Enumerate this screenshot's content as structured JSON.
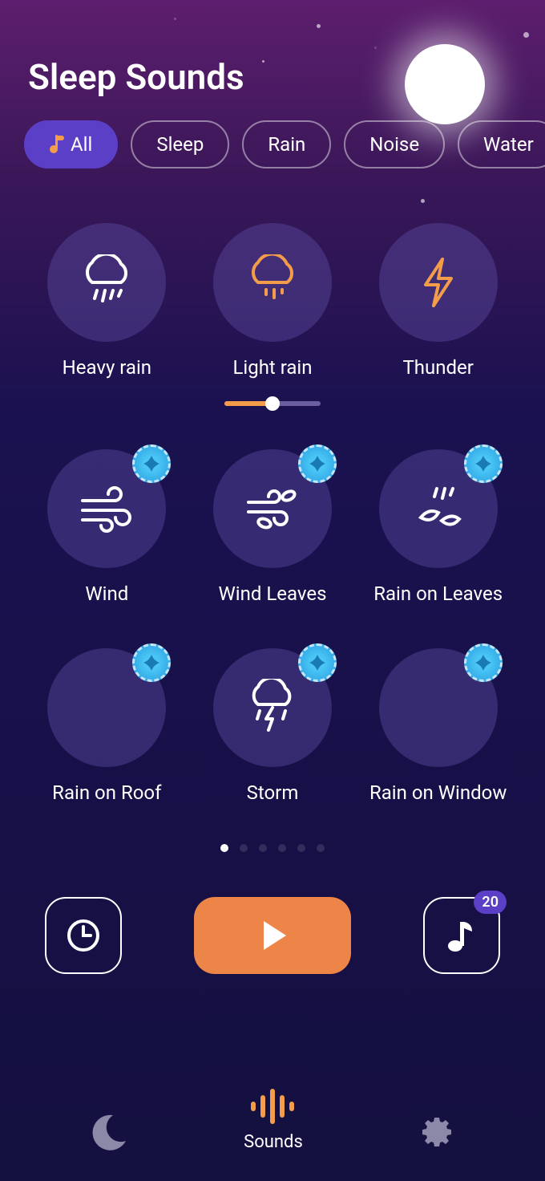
{
  "title": "Sleep Sounds",
  "colors": {
    "accent": "#f39c4a",
    "primary": "#5b3fc7",
    "play": "#ed8548"
  },
  "tabs": [
    {
      "label": "All",
      "active": true,
      "icon": "music-note-icon"
    },
    {
      "label": "Sleep",
      "active": false
    },
    {
      "label": "Rain",
      "active": false
    },
    {
      "label": "Noise",
      "active": false
    },
    {
      "label": "Water",
      "active": false
    }
  ],
  "sounds": [
    {
      "label": "Heavy rain",
      "icon": "heavy-rain-icon",
      "locked": false,
      "playing": false
    },
    {
      "label": "Light rain",
      "icon": "light-rain-icon",
      "locked": false,
      "playing": true,
      "volume": 0.5
    },
    {
      "label": "Thunder",
      "icon": "thunder-icon",
      "locked": false,
      "playing": false
    },
    {
      "label": "Wind",
      "icon": "wind-icon",
      "locked": true,
      "playing": false
    },
    {
      "label": "Wind Leaves",
      "icon": "wind-leaves-icon",
      "locked": true,
      "playing": false
    },
    {
      "label": "Rain on Leaves",
      "icon": "rain-on-leaves-icon",
      "locked": true,
      "playing": false
    },
    {
      "label": "Rain on Roof",
      "icon": "rain-on-roof-icon",
      "locked": true,
      "playing": false
    },
    {
      "label": "Storm",
      "icon": "storm-icon",
      "locked": true,
      "playing": false
    },
    {
      "label": "Rain on Window",
      "icon": "rain-on-window-icon",
      "locked": true,
      "playing": false
    }
  ],
  "pagination": {
    "total": 6,
    "active": 0
  },
  "controls": {
    "timer": {
      "icon": "clock-icon"
    },
    "play": {
      "icon": "play-icon"
    },
    "playlist": {
      "icon": "music-note-icon",
      "count": "20"
    }
  },
  "nav": {
    "items": [
      {
        "label": "",
        "icon": "moon-icon",
        "active": false
      },
      {
        "label": "Sounds",
        "icon": "soundwave-icon",
        "active": true
      },
      {
        "label": "",
        "icon": "gear-icon",
        "active": false
      }
    ]
  }
}
